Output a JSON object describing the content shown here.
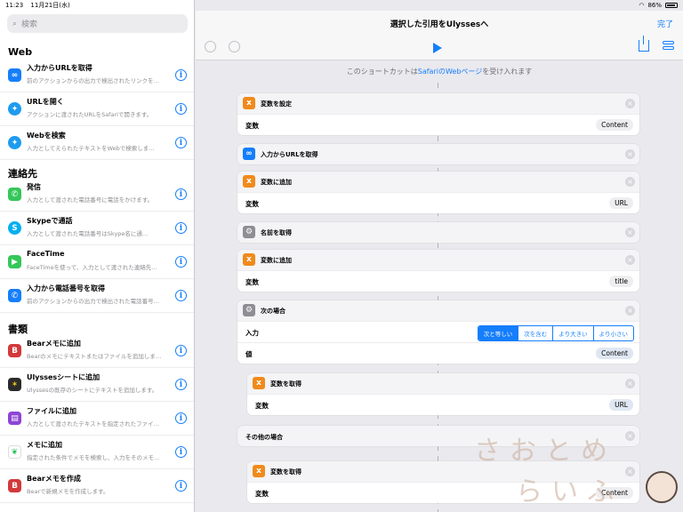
{
  "status": {
    "time": "11:23",
    "date": "11月21日(水)",
    "battery": "86%"
  },
  "search": {
    "placeholder": "検索"
  },
  "sidebar": {
    "sections": [
      {
        "title": "Web",
        "items": [
          {
            "title": "入力からURLを取得",
            "subtitle": "前のアクションからの出力で検出されたリンクを…",
            "icon": "link-icon",
            "color": "#157efb"
          },
          {
            "title": "URLを開く",
            "subtitle": "アクションに渡されたURLをSafariで開きます。",
            "icon": "safari-icon",
            "color": "#1e9bf0"
          },
          {
            "title": "Webを検索",
            "subtitle": "入力としてえられたテキストをWebで検索しま…",
            "icon": "safari-icon",
            "color": "#1e9bf0"
          }
        ]
      },
      {
        "title": "連絡先",
        "items": [
          {
            "title": "発信",
            "subtitle": "入力として渡された電話番号に電話をかけます。",
            "icon": "phone-icon",
            "color": "#34c759"
          },
          {
            "title": "Skypeで通話",
            "subtitle": "入力として渡された電話番号はSkype名に通…",
            "icon": "skype-icon",
            "color": "#00aff0"
          },
          {
            "title": "FaceTime",
            "subtitle": "FaceTimeを使って、入力として渡された連絡先…",
            "icon": "facetime-icon",
            "color": "#34c759"
          },
          {
            "title": "入力から電話番号を取得",
            "subtitle": "前のアクションからの出力で検出された電話番号…",
            "icon": "phone-icon",
            "color": "#157efb"
          }
        ]
      },
      {
        "title": "書類",
        "items": [
          {
            "title": "Bearメモに追加",
            "subtitle": "Bearのメモにテキストまたはファイルを追加しま…",
            "icon": "bear-icon",
            "color": "#d3393b"
          },
          {
            "title": "Ulyssesシートに追加",
            "subtitle": "Ulyssesの既存のシートにテキストを追加します。",
            "icon": "ulysses-icon",
            "color": "#2b2b2b"
          },
          {
            "title": "ファイルに追加",
            "subtitle": "入力として渡されたテキストを指定されたファイ…",
            "icon": "file-icon",
            "color": "#8e44d6"
          },
          {
            "title": "メモに追加",
            "subtitle": "指定された条件でメモを検索し、入力をそのメモ…",
            "icon": "evernote-icon",
            "color": "#ffffff"
          },
          {
            "title": "Bearメモを作成",
            "subtitle": "Bearで新規メモを作成します。",
            "icon": "bear-icon",
            "color": "#d3393b"
          }
        ]
      }
    ]
  },
  "header": {
    "title": "選択した引用をUlyssesへ",
    "done": "完了"
  },
  "accept": {
    "pre": "このショートカットは",
    "hl": "SafariのWebページ",
    "post": "を受け入れます"
  },
  "actions": [
    {
      "label": "変数を設定",
      "row_k": "変数",
      "row_v": "Content"
    },
    {
      "label": "入力からURLを取得"
    },
    {
      "label": "変数に追加",
      "row_k": "変数",
      "row_v": "URL"
    },
    {
      "label": "名前を取得"
    },
    {
      "label": "変数に追加",
      "row_k": "変数",
      "row_v": "title"
    },
    {
      "label": "次の場合",
      "row_k": "入力",
      "row2_k": "値",
      "row2_v": "Content",
      "options": [
        "次と等しい",
        "次を含む",
        "より大きい",
        "より小さい"
      ]
    },
    {
      "label": "変数を取得",
      "row_k": "変数",
      "row_v": "URL"
    },
    {
      "label": "その他の場合"
    },
    {
      "label": "変数を取得",
      "row_k": "変数",
      "row_v": "Content"
    }
  ],
  "watermark": {
    "line1": "さおとめ",
    "line2": "らいふ"
  }
}
